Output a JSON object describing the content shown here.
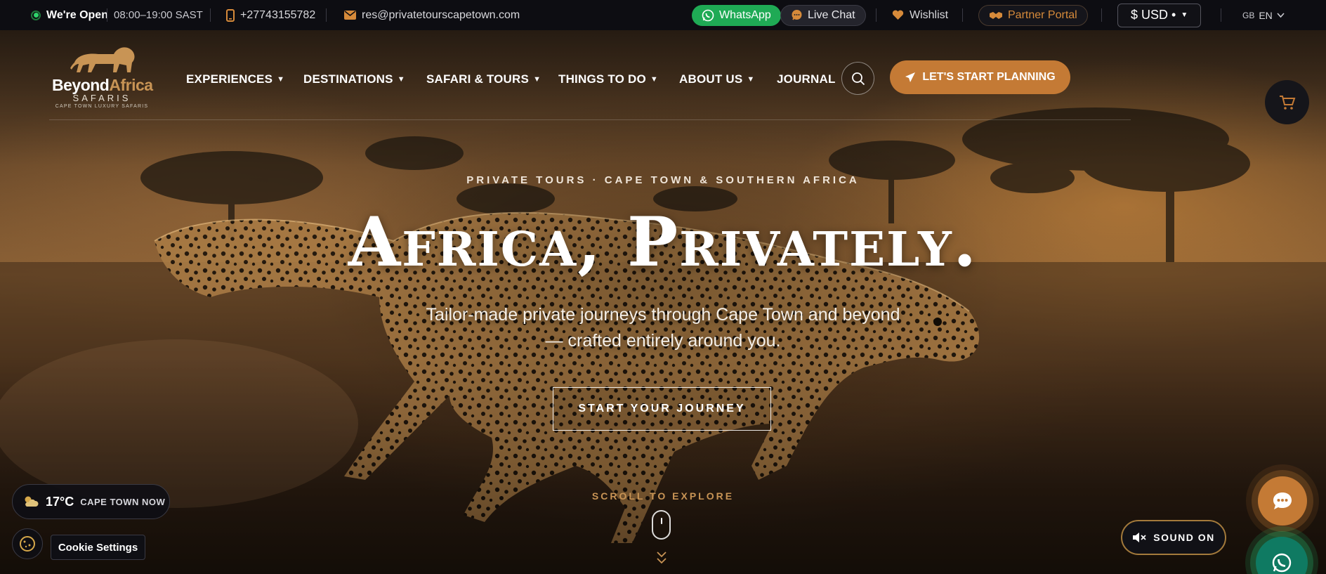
{
  "topbar": {
    "open_label": "We're Open",
    "hours": "08:00–19:00 SAST",
    "phone": "+27743155782",
    "email": "res@privatetourscapetown.com",
    "whatsapp_label": "WhatsApp",
    "livechat_label": "Live Chat",
    "wishlist_label": "Wishlist",
    "partner_label": "Partner Portal",
    "currency_label": "$ USD •",
    "lang_region": "GB",
    "lang_label": "EN"
  },
  "logo": {
    "name_part1": "Beyond",
    "name_part2": "Africa",
    "sub": "SAFARIS",
    "tagline": "CAPE TOWN LUXURY SAFARIS"
  },
  "nav": {
    "items": [
      {
        "label": "EXPERIENCES"
      },
      {
        "label": "DESTINATIONS"
      },
      {
        "label": "SAFARI & TOURS"
      },
      {
        "label": "THINGS TO DO"
      },
      {
        "label": "ABOUT US"
      },
      {
        "label": "JOURNAL"
      }
    ],
    "cta_label": "LET'S START PLANNING"
  },
  "hero": {
    "eyebrow": "PRIVATE TOURS · CAPE TOWN & SOUTHERN AFRICA",
    "headline": "Africa, Privately.",
    "subtitle": "Tailor-made private journeys through Cape Town and beyond — crafted entirely around you.",
    "button_label": "START YOUR JOURNEY",
    "scroll_label": "SCROLL TO EXPLORE"
  },
  "widgets": {
    "weather_temp": "17°C",
    "weather_city": "CAPE TOWN NOW",
    "cookie_label": "Cookie Settings",
    "sound_label": "SOUND ON"
  },
  "colors": {
    "accent": "#c47a35",
    "whatsapp": "#1faa55",
    "topbar_bg": "#0d0d12",
    "open_dot": "#2fd36b"
  },
  "icons": [
    "open-status-icon",
    "phone-icon",
    "mail-icon",
    "whatsapp-icon",
    "chat-icon",
    "heart-icon",
    "handshake-icon",
    "chevron-down-icon",
    "search-icon",
    "paper-plane-icon",
    "cart-icon",
    "weather-icon",
    "cookie-icon",
    "mute-icon",
    "scroll-mouse-icon"
  ]
}
